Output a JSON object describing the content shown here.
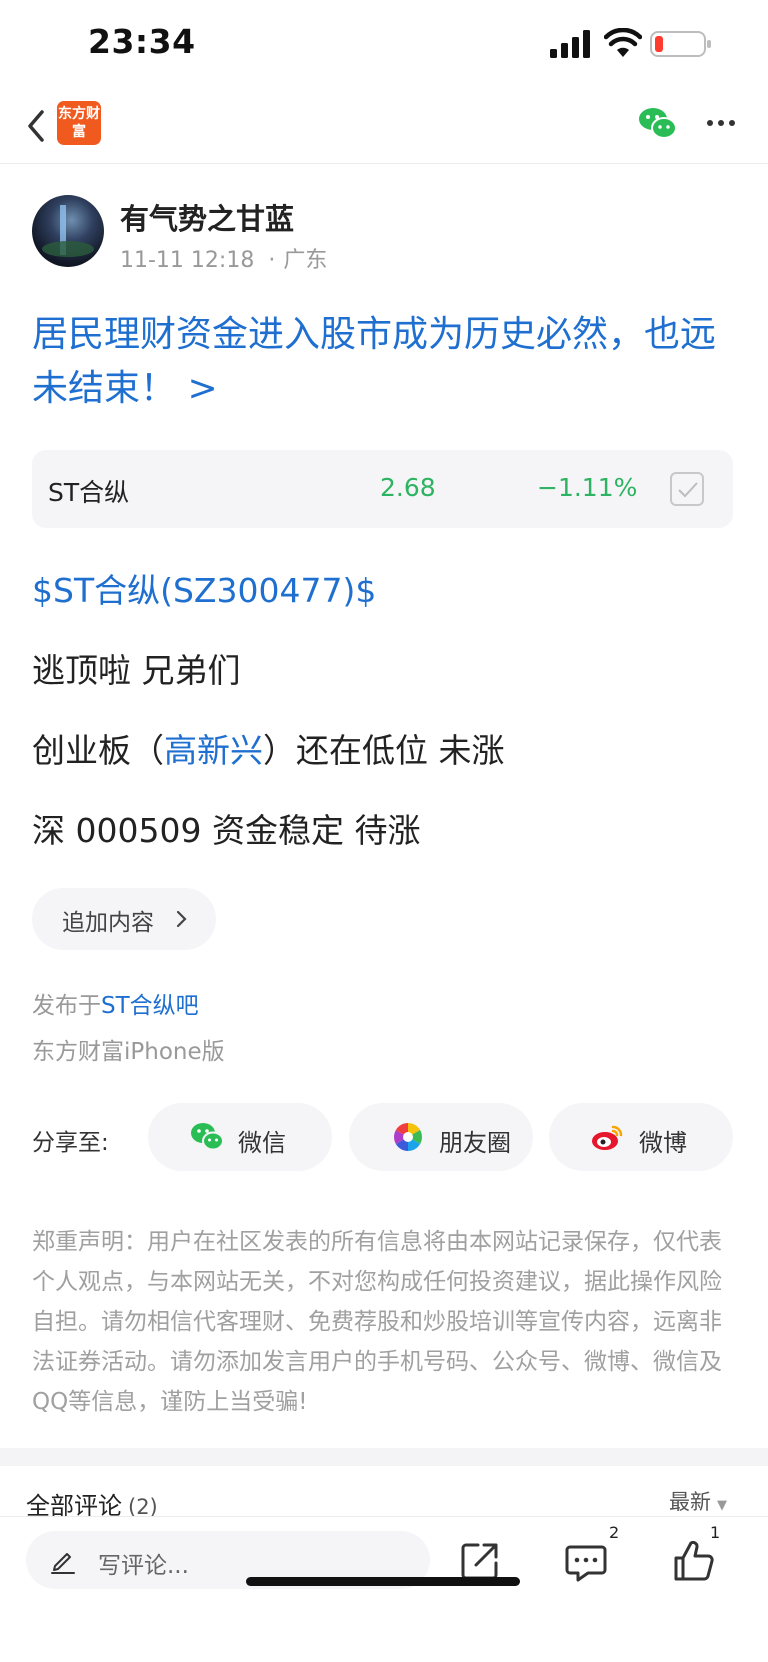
{
  "status_bar": {
    "time": "23:34"
  },
  "nav": {
    "logo_text": "东方财富"
  },
  "author": {
    "name": "有气势之甘蓝",
    "date": "11-11 12:18",
    "location": "广东"
  },
  "post": {
    "title": "居民理财资金进入股市成为历史必然，也远未结束！ >",
    "stock_tag": "$ST合纵(SZ300477)$",
    "paragraphs": {
      "p1": "逃顶啦 兄弟们",
      "p2_before": "创业板（",
      "p2_link": "高新兴",
      "p2_after": "）还在低位 未涨",
      "p3": "深 000509 资金稳定 待涨"
    }
  },
  "stock_card": {
    "name": "ST合纵",
    "price": "2.68",
    "change": "−1.11%",
    "color": "#2db362"
  },
  "actions": {
    "append_label": "追加内容"
  },
  "published": {
    "prefix": "发布于",
    "bar": "ST合纵吧",
    "client": "东方财富iPhone版"
  },
  "share": {
    "label": "分享至:",
    "buttons": {
      "wechat": "微信",
      "moments": "朋友圈",
      "weibo": "微博"
    }
  },
  "disclaimer": "郑重声明：用户在社区发表的所有信息将由本网站记录保存，仅代表个人观点，与本网站无关，不对您构成任何投资建议，据此操作风险自担。请勿相信代客理财、免费荐股和炒股培训等宣传内容，远离非法证券活动。请勿添加发言用户的手机号码、公众号、微博、微信及QQ等信息，谨防上当受骗!",
  "comments": {
    "title": "全部评论",
    "count": "(2)",
    "sort": "最新"
  },
  "bottom_bar": {
    "placeholder": "写评论...",
    "comment_badge": "2",
    "like_badge": "1"
  },
  "colors": {
    "link_blue": "#1f6fd0",
    "stock_green": "#2db362",
    "brand_orange": "#f05a1e",
    "battery_red": "#ff3b30"
  },
  "icons": [
    "back-icon",
    "wechat-icon",
    "more-icon",
    "check-icon",
    "chevron-right-icon",
    "moments-icon",
    "weibo-icon",
    "pen-icon",
    "share-out-icon",
    "comment-icon",
    "like-icon"
  ]
}
